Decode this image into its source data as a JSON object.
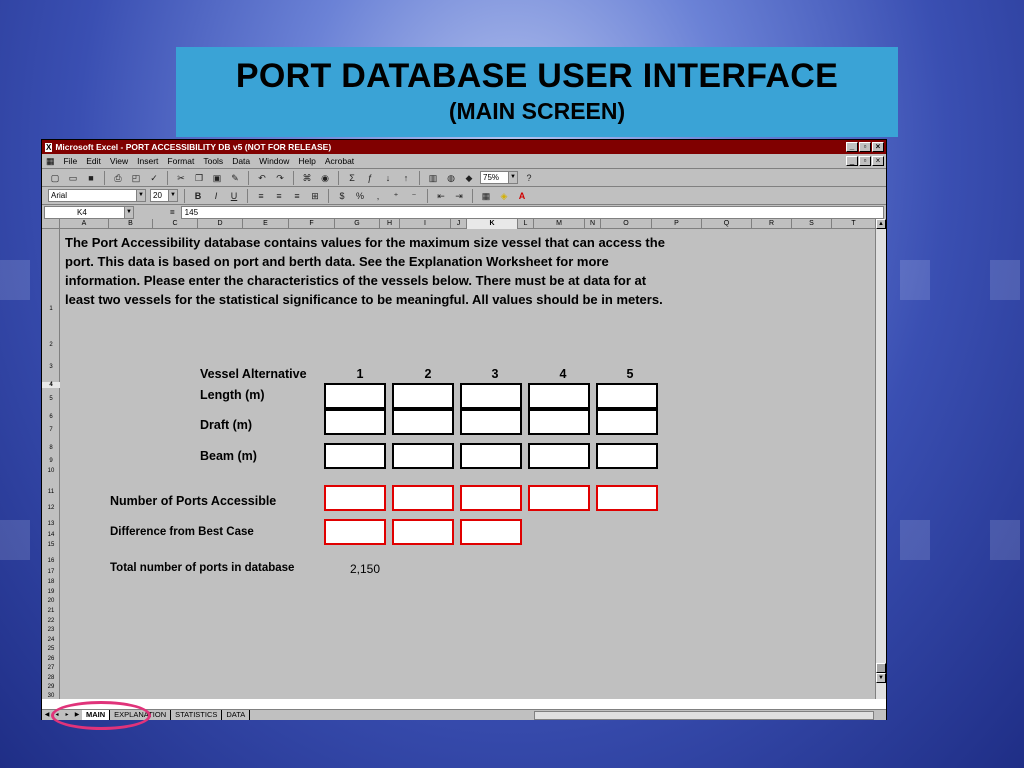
{
  "slide": {
    "title": "PORT DATABASE USER INTERFACE",
    "subtitle": "(MAIN SCREEN)"
  },
  "window": {
    "title": "Microsoft Excel - PORT ACCESSIBILITY DB v5 (NOT FOR RELEASE)",
    "menu": [
      "File",
      "Edit",
      "View",
      "Insert",
      "Format",
      "Tools",
      "Data",
      "Window",
      "Help",
      "Acrobat"
    ],
    "zoom": "75%",
    "font_name": "Arial",
    "font_size": "20",
    "name_box": "K4",
    "formula_eq": "=",
    "formula_value": "145"
  },
  "columns": [
    "A",
    "B",
    "C",
    "D",
    "E",
    "F",
    "G",
    "H",
    "I",
    "J",
    "K",
    "L",
    "M",
    "N",
    "O",
    "P",
    "Q",
    "R",
    "S",
    "T"
  ],
  "rows": [
    "1",
    "2",
    "3",
    "4",
    "5",
    "6",
    "7",
    "8",
    "9",
    "10",
    "11",
    "12",
    "13",
    "14",
    "15",
    "16",
    "17",
    "18",
    "19",
    "20",
    "21",
    "22",
    "23",
    "24",
    "25",
    "26",
    "27",
    "28",
    "29",
    "30"
  ],
  "sheet": {
    "intro": "The Port Accessibility database contains values for the maximum size vessel that can access the port. This data is based on port and berth data.  See the Explanation Worksheet for more information.  Please enter the characteristics of the vessels below.  There must be at data for at least two vessels for the statistical significance to be meaningful.  All values should be in meters.",
    "vessel_label": "Vessel Alternative",
    "vessel_numbers": [
      "1",
      "2",
      "3",
      "4",
      "5"
    ],
    "length_label": "Length (m)",
    "draft_label": "Draft (m)",
    "beam_label": "Beam (m)",
    "ports_accessible_label": "Number of Ports Accessible",
    "difference_label": "Difference from Best Case",
    "total_label": "Total number of ports in database",
    "total_value": "2,150"
  },
  "tabs": [
    "MAIN",
    "EXPLANATION",
    "STATISTICS",
    "DATA"
  ],
  "active_tab": "MAIN",
  "colors": {
    "title_bar": "#800000",
    "slide_title_bg": "#3aa3d6",
    "output_border": "#e00000",
    "highlight_oval": "#e0337a"
  }
}
